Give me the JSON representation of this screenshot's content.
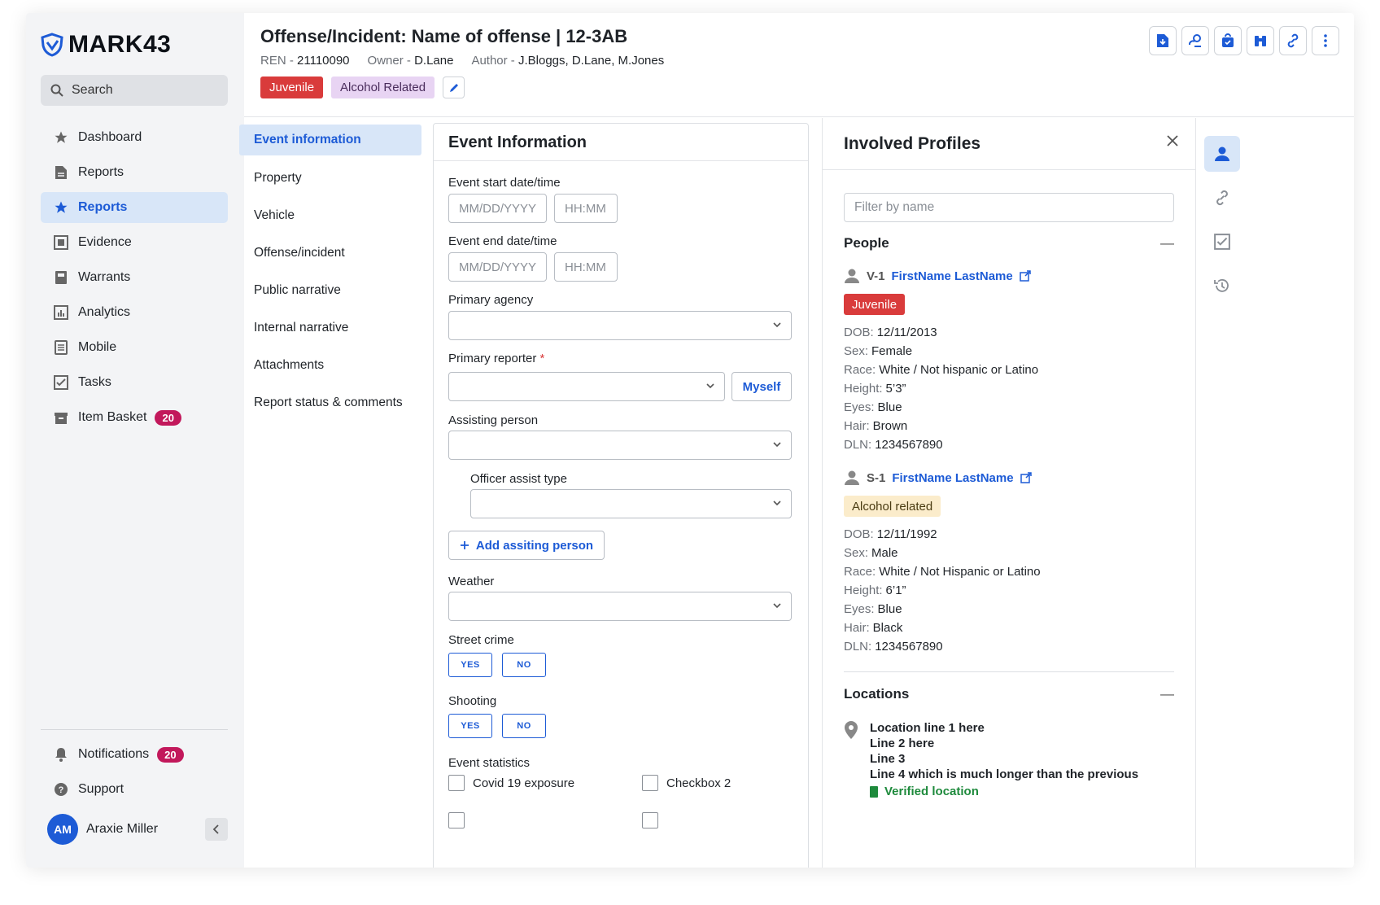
{
  "sidebar": {
    "logo": "MARK43",
    "search_label": "Search",
    "items": [
      {
        "label": "Dashboard",
        "icon": "star-icon"
      },
      {
        "label": "Reports",
        "icon": "document-icon"
      },
      {
        "label": "Reports",
        "icon": "star-icon",
        "active": true
      },
      {
        "label": "Evidence",
        "icon": "evidence-icon"
      },
      {
        "label": "Warrants",
        "icon": "warrant-icon"
      },
      {
        "label": "Analytics",
        "icon": "chart-icon"
      },
      {
        "label": "Mobile",
        "icon": "mobile-icon"
      },
      {
        "label": "Tasks",
        "icon": "checkbox-icon"
      },
      {
        "label": "Item Basket",
        "icon": "basket-icon",
        "badge": "20"
      }
    ],
    "notifications": {
      "label": "Notifications",
      "badge": "20"
    },
    "support": {
      "label": "Support"
    },
    "user": {
      "initials": "AM",
      "name": "Araxie Miller"
    }
  },
  "header": {
    "title": "Offense/Incident: Name of offense | 12-3AB",
    "ren_key": "REN",
    "ren_value": "21110090",
    "owner_key": "Owner",
    "owner_value": "D.Lane",
    "author_key": "Author",
    "author_value": "J.Bloggs, D.Lane, M.Jones",
    "tags": [
      "Juvenile",
      "Alcohol Related"
    ]
  },
  "sections": [
    "Event information",
    "Property",
    "Vehicle",
    "Offense/incident",
    "Public narrative",
    "Internal narrative",
    "Attachments",
    "Report status & comments"
  ],
  "form": {
    "title": "Event Information",
    "start_label": "Event start date/time",
    "end_label": "Event end date/time",
    "date_placeholder": "MM/DD/YYYY",
    "time_placeholder": "HH:MM",
    "primary_agency": "Primary agency",
    "primary_reporter": "Primary reporter",
    "required_mark": "*",
    "myself": "Myself",
    "assisting_person": "Assisting person",
    "officer_assist_type": "Officer assist type",
    "add_assisting": "Add assiting person",
    "weather": "Weather",
    "street_crime": "Street crime",
    "shooting": "Shooting",
    "yes": "YES",
    "no": "NO",
    "event_statistics": "Event statistics",
    "checkbox1": "Covid 19 exposure",
    "checkbox2": "Checkbox 2"
  },
  "profiles": {
    "title": "Involved Profiles",
    "filter_placeholder": "Filter by name",
    "people_label": "People",
    "people": [
      {
        "id": "V-1",
        "name": "FirstName LastName",
        "tag": "Juvenile",
        "tag_color": "#d93b3b",
        "attrs": [
          {
            "k": "DOB:",
            "v": "12/11/2013"
          },
          {
            "k": "Sex:",
            "v": "Female"
          },
          {
            "k": "Race:",
            "v": "White / Not hispanic or Latino"
          },
          {
            "k": "Height:",
            "v": "5’3”"
          },
          {
            "k": "Eyes:",
            "v": "Blue"
          },
          {
            "k": "Hair:",
            "v": "Brown"
          },
          {
            "k": "DLN:",
            "v": "1234567890"
          }
        ]
      },
      {
        "id": "S-1",
        "name": "FirstName LastName",
        "tag": "Alcohol related",
        "tag_color": "#fbeccb",
        "attrs": [
          {
            "k": "DOB:",
            "v": "12/11/1992"
          },
          {
            "k": "Sex:",
            "v": "Male"
          },
          {
            "k": "Race:",
            "v": "White / Not Hispanic or Latino"
          },
          {
            "k": "Height:",
            "v": "6’1”"
          },
          {
            "k": "Eyes:",
            "v": "Blue"
          },
          {
            "k": "Hair:",
            "v": "Black"
          },
          {
            "k": "DLN:",
            "v": "1234567890"
          }
        ]
      }
    ],
    "locations_label": "Locations",
    "location": {
      "line1": "Location line 1 here",
      "line2": "Line 2 here",
      "line3": "Line 3",
      "line4": "Line 4 which is much longer than the previous",
      "verified": "Verified location"
    }
  },
  "colors": {
    "accent": "#1d5bd6",
    "danger": "#d93b3b",
    "badge": "#c2185b",
    "success": "#1e8a3c"
  }
}
